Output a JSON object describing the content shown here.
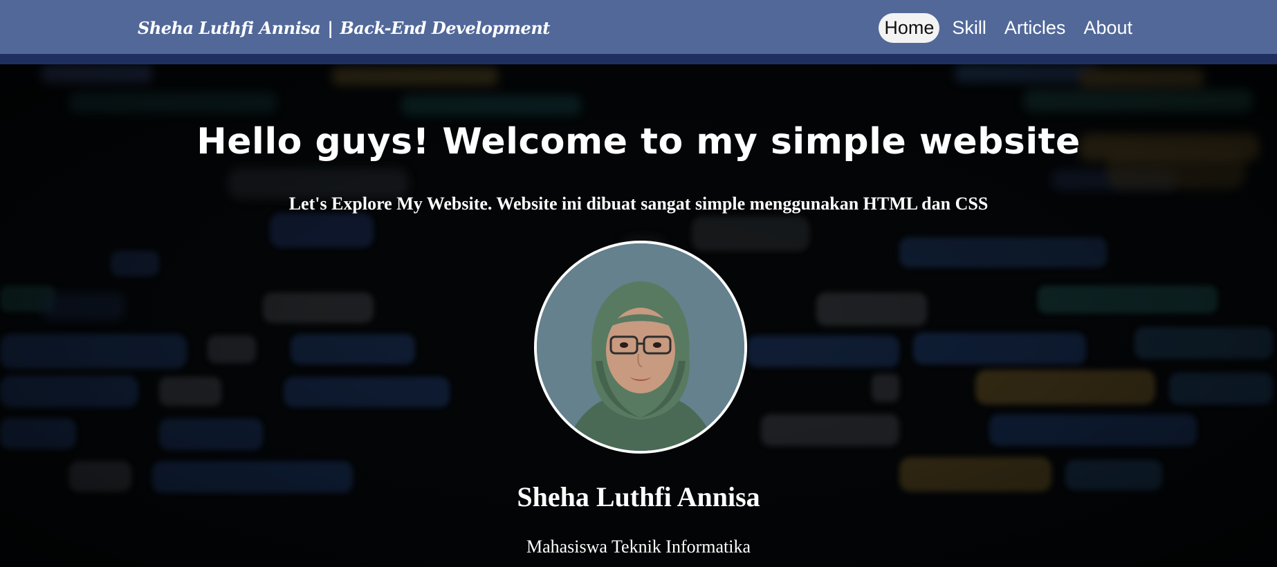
{
  "navbar": {
    "brand_name": "Sheha Luthfi Annisa",
    "brand_separator": "|",
    "brand_role": "Back-End Development",
    "links": [
      {
        "label": "Home",
        "active": true
      },
      {
        "label": "Skill",
        "active": false
      },
      {
        "label": "Articles",
        "active": false
      },
      {
        "label": "About",
        "active": false
      }
    ],
    "colors": {
      "bar": "#516899",
      "bar_border": "#1f3060",
      "active_pill": "#f3f3f3"
    }
  },
  "hero": {
    "title": "Hello guys! Welcome to my simple website",
    "subtitle": "Let's Explore My Website. Website ini dibuat sangat simple menggunakan HTML dan CSS",
    "background": "blurred-code-background",
    "avatar": "profile-photo",
    "name": "Sheha Luthfi Annisa",
    "role": "Mahasiswa Teknik Informatika"
  }
}
